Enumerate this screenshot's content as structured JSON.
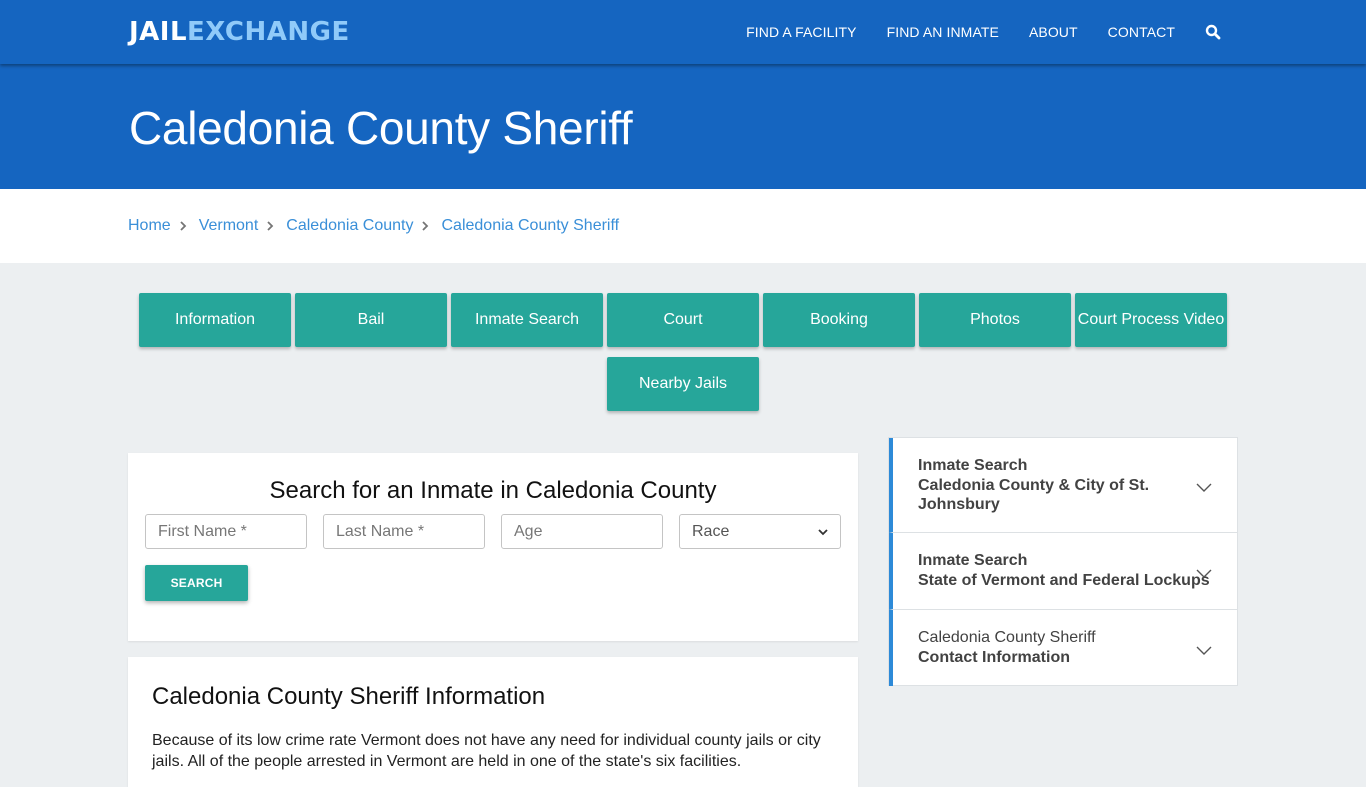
{
  "brand": {
    "part1": "JAIL",
    "part2": "EXCHANGE"
  },
  "nav": {
    "items": [
      "FIND A FACILITY",
      "FIND AN INMATE",
      "ABOUT",
      "CONTACT"
    ],
    "search_icon": "search-icon"
  },
  "hero": {
    "title": "Caledonia County Sheriff"
  },
  "breadcrumb": [
    "Home",
    "Vermont",
    "Caledonia County",
    "Caledonia County Sheriff"
  ],
  "tabs": [
    "Information",
    "Bail",
    "Inmate Search",
    "Court",
    "Booking",
    "Photos",
    "Court Process Video",
    "Nearby Jails"
  ],
  "search_form": {
    "title": "Search for an Inmate in Caledonia County",
    "first_name_placeholder": "First Name *",
    "last_name_placeholder": "Last Name *",
    "age_placeholder": "Age",
    "race_selected": "Race",
    "submit_label": "SEARCH"
  },
  "info": {
    "title": "Caledonia County Sheriff Information",
    "body": "Because of its low crime rate Vermont does not have any need for individual county jails or city jails. All of the people arrested in Vermont are held in one of the state's six facilities."
  },
  "sidebar": [
    {
      "line1": "Inmate Search",
      "line2": "Caledonia County & City of St. Johnsbury",
      "line1_bold": true
    },
    {
      "line1": "Inmate Search",
      "line2": "State of Vermont and Federal Lockups",
      "line1_bold": true
    },
    {
      "line1": "Caledonia County Sheriff",
      "line2": "Contact Information",
      "line1_bold": false
    }
  ],
  "colors": {
    "primary": "#1565c0",
    "accent": "#26a69a",
    "link": "#3a8fd8",
    "logo_light": "#90caf9"
  }
}
